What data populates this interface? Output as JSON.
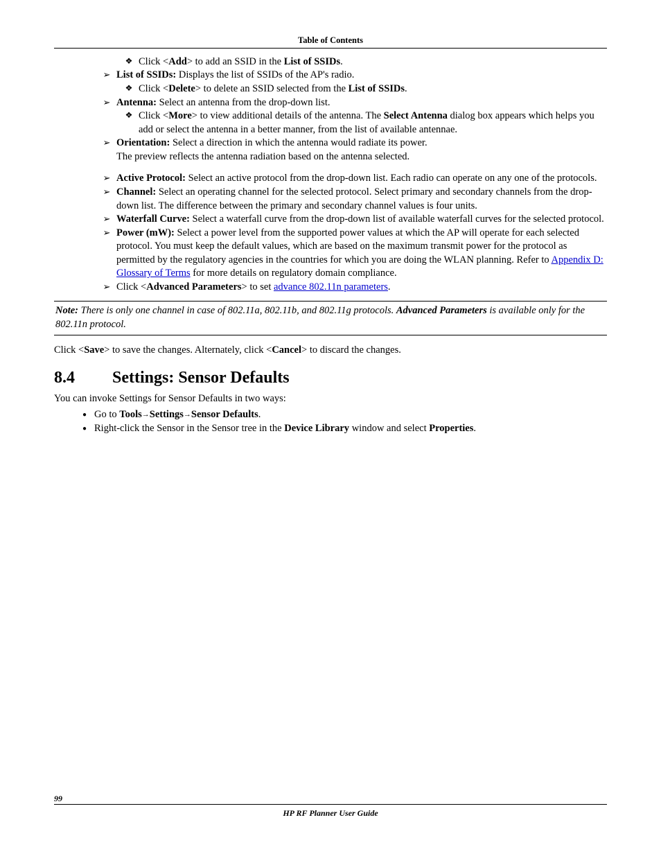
{
  "header": {
    "title": "Table of Contents"
  },
  "footer": {
    "page": "99",
    "book": "HP RF Planner User Guide"
  },
  "content": {
    "add_ssid_pre": "Click <",
    "add_ssid_btn": "Add",
    "add_ssid_mid": "> to add an SSID in the ",
    "add_ssid_tgt": "List of SSIDs",
    "period": ".",
    "list_ssids_label": "List of SSIDs:",
    "list_ssids_text": " Displays the list of SSIDs of the AP's radio.",
    "delete_pre": "Click <",
    "delete_btn": "Delete",
    "delete_mid": "> to delete an SSID selected from the ",
    "delete_tgt": "List of SSIDs",
    "antenna_label": "Antenna:",
    "antenna_text": " Select an antenna from the drop-down list.",
    "more_pre": "Click <",
    "more_btn": "More",
    "more_mid": "> to view additional details of the antenna. The ",
    "more_dlg": "Select Antenna",
    "more_post": " dialog box appears which helps you add or select the antenna in a better manner, from the list of available antennae.",
    "orientation_label": "Orientation:",
    "orientation_text": " Select a direction in which the antenna would radiate its power.",
    "orientation_line2": "The preview reflects the antenna radiation based on the antenna selected.",
    "active_label": "Active Protocol:",
    "active_text": " Select an active protocol from the drop-down list. Each radio can operate on any one of the protocols.",
    "channel_label": "Channel:",
    "channel_text": " Select an operating channel for the selected protocol. Select primary and secondary channels from the drop-down list. The difference between the primary and secondary channel values is four units.",
    "waterfall_label": "Waterfall Curve:",
    "waterfall_text": " Select a waterfall curve from the drop-down list of available waterfall curves for the selected protocol.",
    "power_label": "Power (mW):",
    "power_text": " Select a power level from the supported power values at which the AP will operate for each selected protocol. You must keep the default values, which are based on the maximum transmit power for the protocol as permitted by the regulatory agencies in the countries for which you are doing the WLAN planning. Refer to ",
    "power_link": "Appendix D: Glossary of Terms",
    "power_post": " for more details on regulatory domain compliance.",
    "adv_pre": "Click <",
    "adv_btn": "Advanced Parameters",
    "adv_mid": "> to set ",
    "adv_link": "advance 802.11n parameters",
    "note_label": "Note:",
    "note_part1": " There is only one channel in case of 802.11a, 802.11b, and 802.11g protocols. ",
    "note_bold": "Advanced Parameters",
    "note_part2": " is available only for the 802.11n protocol.",
    "save_pre": "Click <",
    "save_btn": "Save",
    "save_mid": "> to save the changes. Alternately, click <",
    "cancel_btn": "Cancel",
    "save_post": "> to discard the changes.",
    "section_num": "8.4",
    "section_title": "Settings: Sensor Defaults",
    "section_intro": "You can invoke Settings for Sensor Defaults in two ways:",
    "goto_pre": "Go to ",
    "goto_tools": "Tools",
    "goto_settings": "Settings",
    "goto_sensor": "Sensor Defaults",
    "rclick_pre": "Right-click the Sensor in the Sensor tree in the ",
    "rclick_lib": "Device Library",
    "rclick_mid": " window and select ",
    "rclick_prop": "Properties"
  }
}
